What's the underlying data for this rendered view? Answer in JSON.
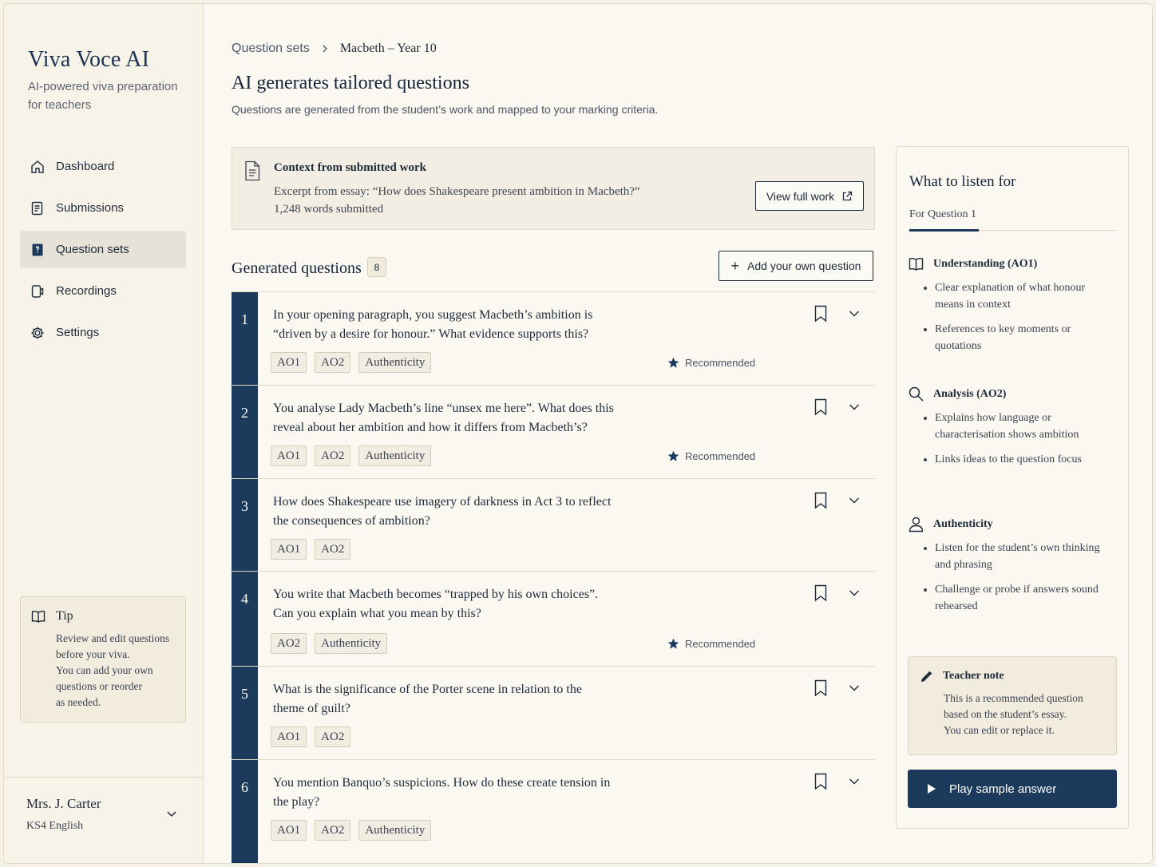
{
  "sidebar": {
    "brand": "Viva Voce AI",
    "tagline": "AI-powered viva preparation for teachers",
    "nav": [
      {
        "label": "Dashboard",
        "icon": "home-icon"
      },
      {
        "label": "Submissions",
        "icon": "document-icon"
      },
      {
        "label": "Question sets",
        "icon": "question-set-icon",
        "active": true
      },
      {
        "label": "Recordings",
        "icon": "recording-icon"
      },
      {
        "label": "Settings",
        "icon": "gear-icon"
      }
    ],
    "tip": {
      "title": "Tip",
      "body": "Review and edit questions\nbefore your viva.\nYou can add your own\nquestions or reorder\nas needed."
    },
    "user": {
      "name": "Mrs. J. Carter",
      "role": "KS4 English"
    }
  },
  "breadcrumb": {
    "parent": "Question sets",
    "current": "Macbeth – Year 10"
  },
  "header": {
    "title": "AI generates tailored questions",
    "subtitle": "Questions are generated from the student’s work and mapped to your marking criteria."
  },
  "context": {
    "title": "Context from submitted work",
    "excerpt": "Excerpt from essay: “How does Shakespeare present ambition in Macbeth?”",
    "words": "1,248 words submitted",
    "view_button": "View full work"
  },
  "generated": {
    "title": "Generated questions",
    "count": "8",
    "add_button": "Add your own question",
    "recommended_label": "Recommended",
    "questions": [
      {
        "num": "1",
        "text": "In your opening paragraph, you suggest Macbeth’s ambition is “driven by a desire for honour.” What evidence supports this?",
        "tags": [
          "AO1",
          "AO2",
          "Authenticity"
        ],
        "recommended": true
      },
      {
        "num": "2",
        "text": "You analyse Lady Macbeth’s line “unsex me here”. What does this reveal about her ambition and how it differs from Macbeth’s?",
        "tags": [
          "AO1",
          "AO2",
          "Authenticity"
        ],
        "recommended": true
      },
      {
        "num": "3",
        "text": "How does Shakespeare use imagery of darkness in Act 3 to reflect the consequences of ambition?",
        "tags": [
          "AO1",
          "AO2"
        ],
        "recommended": false
      },
      {
        "num": "4",
        "text": "You write that Macbeth becomes “trapped by his own choices”. Can you explain what you mean by this?",
        "tags": [
          "AO2",
          "Authenticity"
        ],
        "recommended": true
      },
      {
        "num": "5",
        "text": "What is the significance of the Porter scene in relation to the theme of guilt?",
        "tags": [
          "AO1",
          "AO2"
        ],
        "recommended": false
      },
      {
        "num": "6",
        "text": "You mention Banquo’s suspicions. How do these create tension in the play?",
        "tags": [
          "AO1",
          "AO2",
          "Authenticity"
        ],
        "recommended": false
      }
    ]
  },
  "listen": {
    "title": "What to listen for",
    "tab": "For Question 1",
    "criteria": [
      {
        "title": "Understanding (AO1)",
        "icon": "book-icon",
        "points": [
          "Clear explanation of what honour means in context",
          "References to key moments or quotations"
        ]
      },
      {
        "title": "Analysis (AO2)",
        "icon": "magnifier-icon",
        "points": [
          "Explains how language or characterisation shows ambition",
          "Links ideas to the question focus"
        ]
      },
      {
        "title": "Authenticity",
        "icon": "person-icon",
        "points": [
          "Listen for the student’s own thinking and phrasing",
          "Challenge or probe if answers sound rehearsed"
        ]
      }
    ],
    "note": {
      "title": "Teacher note",
      "body": "This is a recommended question\nbased on the student’s essay.\nYou can edit or replace it."
    },
    "play_button": "Play sample answer"
  },
  "colors": {
    "accent": "#1c3a5c",
    "background": "#fbf8f1",
    "panel": "#f3eee3"
  }
}
